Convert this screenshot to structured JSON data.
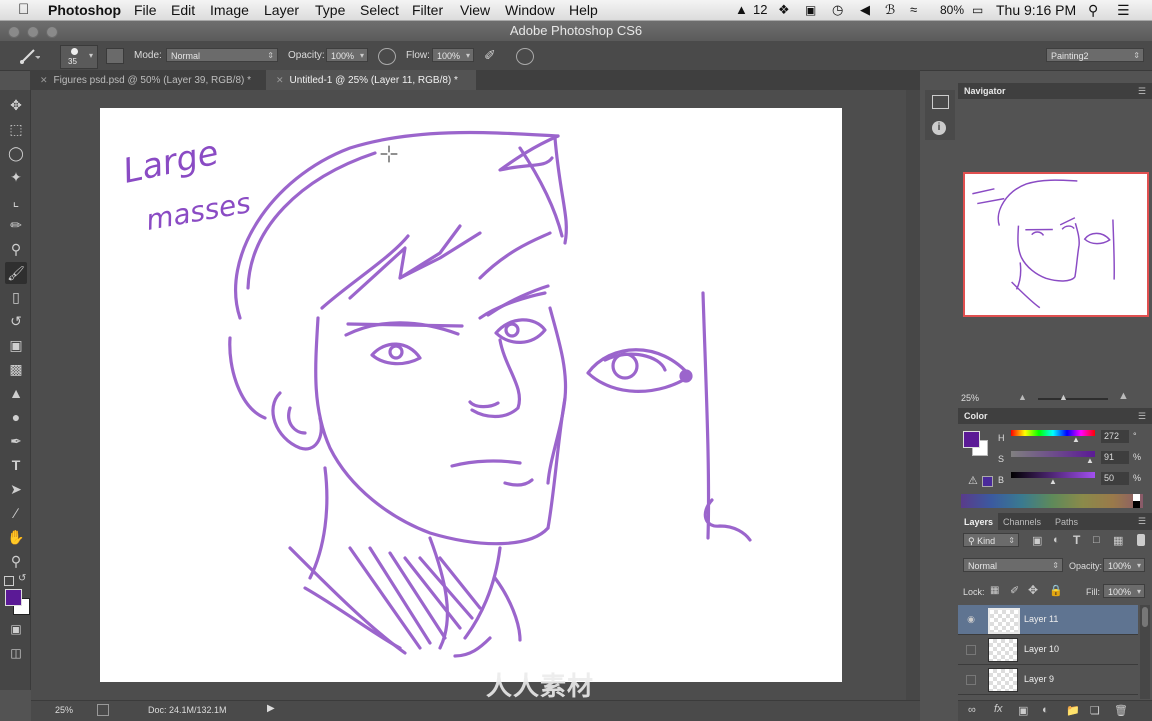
{
  "menubar": {
    "app_name": "Photoshop",
    "items": [
      "File",
      "Edit",
      "Image",
      "Layer",
      "Type",
      "Select",
      "Filter",
      "View",
      "Window",
      "Help"
    ],
    "adobe_count": "12",
    "battery": "80%",
    "clock": "Thu 9:16 PM"
  },
  "window": {
    "title": "Adobe Photoshop CS6"
  },
  "options": {
    "brush_size": "35",
    "mode_label": "Mode:",
    "mode_value": "Normal",
    "opacity_label": "Opacity:",
    "opacity_value": "100%",
    "flow_label": "Flow:",
    "flow_value": "100%",
    "workspace": "Painting2"
  },
  "tabs": [
    {
      "label": "Figures psd.psd @ 50% (Layer 39, RGB/8) *",
      "active": false
    },
    {
      "label": "Untitled-1 @ 25% (Layer 11, RGB/8) *",
      "active": true
    }
  ],
  "canvas": {
    "handwritten_note_line1": "Large",
    "handwritten_note_line2": "masses",
    "stroke_color": "#8a4bc4"
  },
  "status": {
    "zoom": "25%",
    "doc": "Doc: 24.1M/132.1M"
  },
  "watermark": "人人素材",
  "navigator": {
    "title": "Navigator",
    "zoom": "25%"
  },
  "color": {
    "title": "Color",
    "h_label": "H",
    "h_value": "272",
    "h_unit": "°",
    "s_label": "S",
    "s_value": "91",
    "s_unit": "%",
    "b_label": "B",
    "b_value": "50",
    "b_unit": "%",
    "foreground": "#5b1a96",
    "background": "#ffffff"
  },
  "layers": {
    "tabs": [
      "Layers",
      "Channels",
      "Paths"
    ],
    "filter": "Kind",
    "blend_mode": "Normal",
    "opacity_label": "Opacity:",
    "opacity_value": "100%",
    "lock_label": "Lock:",
    "fill_label": "Fill:",
    "fill_value": "100%",
    "items": [
      {
        "name": "Layer 11",
        "visible": true,
        "selected": true
      },
      {
        "name": "Layer 10",
        "visible": false,
        "selected": false
      },
      {
        "name": "Layer 9",
        "visible": false,
        "selected": false
      }
    ]
  }
}
